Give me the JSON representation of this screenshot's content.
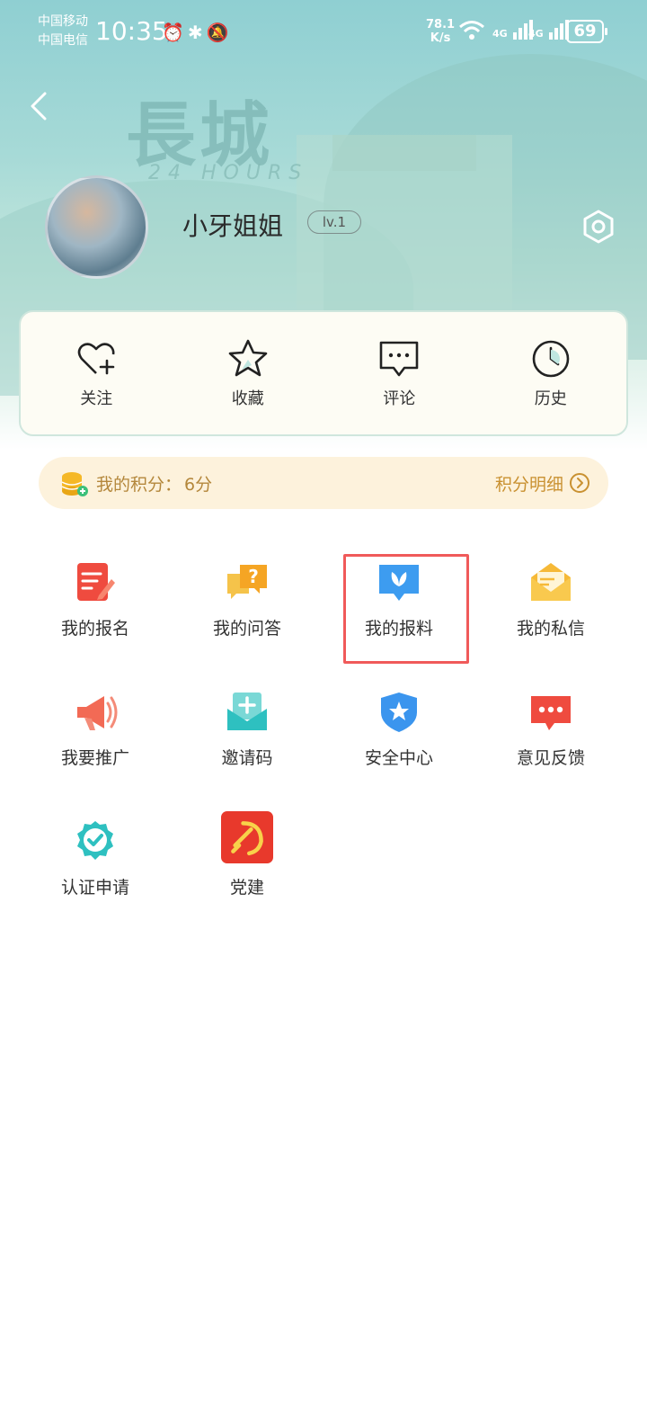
{
  "status_bar": {
    "carrier1": "中国移动",
    "carrier2": "中国电信",
    "time": "10:35",
    "net_speed_value": "78.1",
    "net_speed_unit": "K/s",
    "sig1_label": "4G",
    "sig2_label": "4G",
    "battery": "69"
  },
  "header": {
    "bg_title": "長城",
    "bg_subtitle": "24 HOURS"
  },
  "profile": {
    "username": "小牙姐姐",
    "level": "lv.1"
  },
  "quick_actions": [
    {
      "label": "关注",
      "icon": "heart-plus-icon"
    },
    {
      "label": "收藏",
      "icon": "star-icon"
    },
    {
      "label": "评论",
      "icon": "comment-icon"
    },
    {
      "label": "历史",
      "icon": "clock-icon"
    }
  ],
  "points": {
    "label": "我的积分：",
    "value": "6分",
    "detail_link": "积分明细"
  },
  "menu": [
    {
      "label": "我的报名",
      "icon": "signup-icon",
      "color": "#ef4b3f"
    },
    {
      "label": "我的问答",
      "icon": "qa-icon",
      "color": "#f5a524"
    },
    {
      "label": "我的报料",
      "icon": "report-icon",
      "color": "#3d9cf0"
    },
    {
      "label": "我的私信",
      "icon": "mail-icon",
      "color": "#f6b937"
    },
    {
      "label": "我要推广",
      "icon": "megaphone-icon",
      "color": "#f26a55"
    },
    {
      "label": "邀请码",
      "icon": "invite-icon",
      "color": "#2ec0c0"
    },
    {
      "label": "安全中心",
      "icon": "shield-icon",
      "color": "#3b95ee"
    },
    {
      "label": "意见反馈",
      "icon": "feedback-icon",
      "color": "#ef4b3f"
    },
    {
      "label": "认证申请",
      "icon": "verify-icon",
      "color": "#2ec0c0"
    },
    {
      "label": "党建",
      "icon": "party-icon",
      "color": "#e8392c"
    }
  ],
  "colors": {
    "highlight": "#f05a5a",
    "points_text": "#b4873b",
    "points_bg": "#fdf2dc"
  }
}
